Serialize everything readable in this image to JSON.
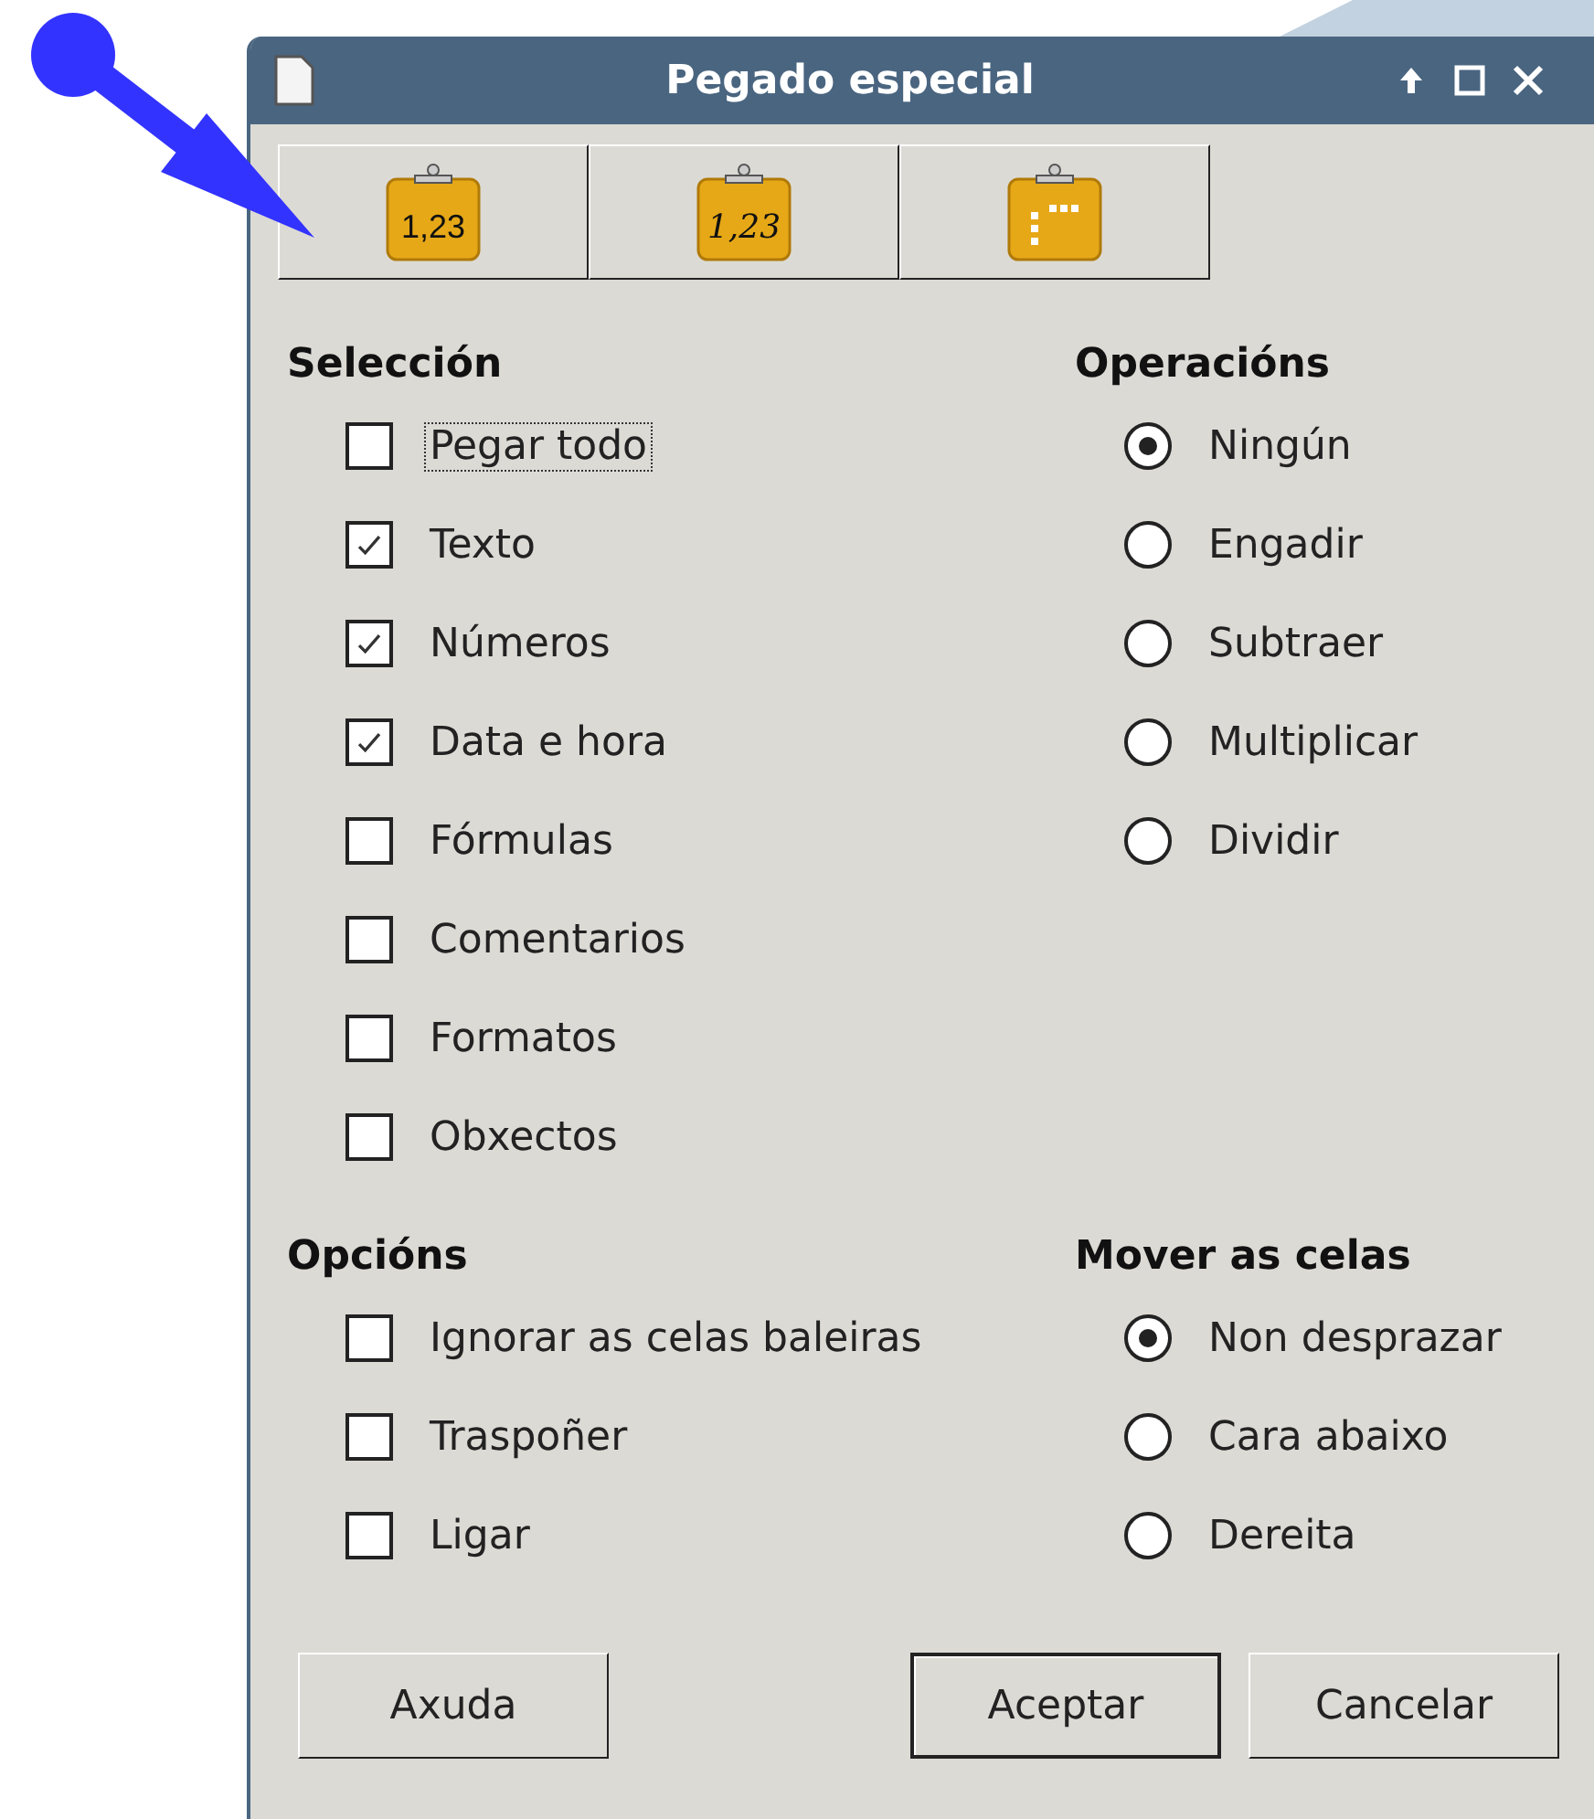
{
  "window": {
    "title": "Pegado especial"
  },
  "paste_buttons": [
    {
      "label": "1,23",
      "kind": "numbers"
    },
    {
      "label": "1,23",
      "kind": "italic"
    },
    {
      "kind": "table"
    }
  ],
  "selection": {
    "title": "Selección",
    "items": [
      {
        "label": "Pegar todo",
        "checked": false,
        "focused": true
      },
      {
        "label": "Texto",
        "checked": true,
        "focused": false
      },
      {
        "label": "Números",
        "checked": true,
        "focused": false
      },
      {
        "label": "Data e hora",
        "checked": true,
        "focused": false
      },
      {
        "label": "Fórmulas",
        "checked": false,
        "focused": false
      },
      {
        "label": "Comentarios",
        "checked": false,
        "focused": false
      },
      {
        "label": "Formatos",
        "checked": false,
        "focused": false
      },
      {
        "label": "Obxectos",
        "checked": false,
        "focused": false
      }
    ]
  },
  "operations": {
    "title": "Operacións",
    "items": [
      {
        "label": "Ningún",
        "selected": true
      },
      {
        "label": "Engadir",
        "selected": false
      },
      {
        "label": "Subtraer",
        "selected": false
      },
      {
        "label": "Multiplicar",
        "selected": false
      },
      {
        "label": "Dividir",
        "selected": false
      }
    ]
  },
  "options": {
    "title": "Opcións",
    "items": [
      {
        "label": "Ignorar as celas baleiras",
        "checked": false
      },
      {
        "label": "Traspoñer",
        "checked": false
      },
      {
        "label": "Ligar",
        "checked": false
      }
    ]
  },
  "move_cells": {
    "title": "Mover as celas",
    "items": [
      {
        "label": "Non desprazar",
        "selected": true
      },
      {
        "label": "Cara abaixo",
        "selected": false
      },
      {
        "label": "Dereita",
        "selected": false
      }
    ]
  },
  "buttons": [
    {
      "label": "Axuda",
      "default": false
    },
    {
      "label": "Aceptar",
      "default": true
    },
    {
      "label": "Cancelar",
      "default": false
    }
  ]
}
